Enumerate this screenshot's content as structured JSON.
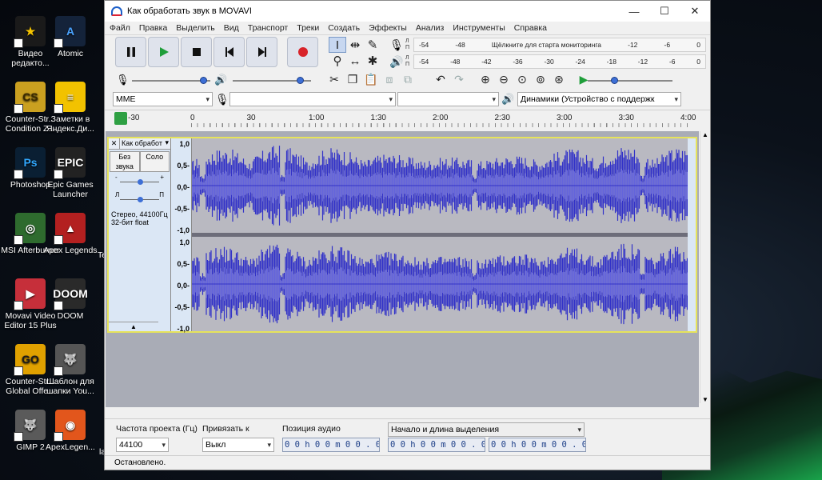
{
  "desktop": {
    "icons": [
      {
        "label": "Видео редакто...",
        "col": 0,
        "row": 0,
        "bg": "#1a1a1a",
        "glyph": "★",
        "fg": "#f5c400"
      },
      {
        "label": "Atomic",
        "col": 1,
        "row": 0,
        "bg": "#14233a",
        "glyph": "A",
        "fg": "#4aa3ff"
      },
      {
        "label": "Counter-Str... Condition Z...",
        "col": 0,
        "row": 1,
        "bg": "#caa020",
        "glyph": "CS",
        "fg": "#3a2a00"
      },
      {
        "label": "Заметки в Яндекс.Ди...",
        "col": 1,
        "row": 1,
        "bg": "#f2c200",
        "glyph": "≡",
        "fg": "#fff"
      },
      {
        "label": "Photoshop",
        "col": 0,
        "row": 2,
        "bg": "#0a1f33",
        "glyph": "Ps",
        "fg": "#31a8ff"
      },
      {
        "label": "Epic Games Launcher",
        "col": 1,
        "row": 2,
        "bg": "#222",
        "glyph": "EPIC",
        "fg": "#fff"
      },
      {
        "label": "MSI Afterburner",
        "col": 0,
        "row": 3,
        "bg": "#2e6b2e",
        "glyph": "◎",
        "fg": "#fff"
      },
      {
        "label": "Apex Legends",
        "col": 1,
        "row": 3,
        "bg": "#b32020",
        "glyph": "▲",
        "fg": "#fff"
      },
      {
        "label": "Movavi Video Editor 15 Plus",
        "col": 0,
        "row": 4,
        "bg": "#c62f3a",
        "glyph": "▶",
        "fg": "#fff"
      },
      {
        "label": "DOOM",
        "col": 1,
        "row": 4,
        "bg": "#2a2a2a",
        "glyph": "DOOM",
        "fg": "#fff"
      },
      {
        "label": "Counter-Str... Global Offe...",
        "col": 0,
        "row": 5,
        "bg": "#e0a100",
        "glyph": "GO",
        "fg": "#1a1a1a"
      },
      {
        "label": "Шаблон для шапки You...",
        "col": 1,
        "row": 5,
        "bg": "#555",
        "glyph": "🐺",
        "fg": "#fff"
      },
      {
        "label": "GIMP 2",
        "col": 0,
        "row": 6,
        "bg": "#5a5a5a",
        "glyph": "🐺",
        "fg": "#fff"
      },
      {
        "label": "ApexLegen...",
        "col": 1,
        "row": 6,
        "bg": "#e2561c",
        "glyph": "◉",
        "fg": "#fff"
      }
    ],
    "partial_labels": {
      "te": "Te",
      "ia": "la"
    }
  },
  "window": {
    "title": "Как обработать звук в MOVAVI",
    "controls": {
      "minimize": "—",
      "maximize": "☐",
      "close": "✕"
    }
  },
  "menu": [
    "Файл",
    "Правка",
    "Выделить",
    "Вид",
    "Транспорт",
    "Треки",
    "Создать",
    "Эффекты",
    "Анализ",
    "Инструменты",
    "Справка"
  ],
  "meters": {
    "record_scale": [
      "-54",
      "-48",
      "Щёлкните для старта мониторинга",
      "-12",
      "-6",
      "0"
    ],
    "play_scale": [
      "-54",
      "-48",
      "-42",
      "-36",
      "-30",
      "-24",
      "-18",
      "-12",
      "-6",
      "0"
    ],
    "lr": [
      "Л",
      "П"
    ]
  },
  "devices": {
    "host": "MME",
    "recording": "",
    "channels": "",
    "playback": "Динамики (Устройство с поддержк"
  },
  "timeline": {
    "ticks": [
      "30",
      "1:00",
      "1:30",
      "2:00",
      "2:30",
      "3:00",
      "3:30",
      "4:00"
    ],
    "start": "0",
    "leading": "-30"
  },
  "track": {
    "name": "Как обработ",
    "mute": "Без звука",
    "solo": "Соло",
    "gain_minus": "-",
    "gain_plus": "+",
    "pan_left": "Л",
    "pan_right": "П",
    "info_line1": "Стерео, 44100Гц",
    "info_line2": "32-бит float",
    "scale": [
      "1,0",
      "0,5-",
      "0,0-",
      "-0,5-",
      "-1,0"
    ],
    "gain_level": 0.5,
    "pan_level": 0.5
  },
  "mixer": {
    "record_volume": 0.95,
    "playback_volume": 0.9,
    "play_speed": 0.3
  },
  "selection_bar": {
    "rate_label": "Частота проекта (Гц)",
    "rate_value": "44100",
    "snap_label": "Привязать к",
    "snap_value": "Выкл",
    "pos_label": "Позиция аудио",
    "pos_value": "0 0 h 0 0 m 0 0 . 0 0 0 s",
    "range_label": "Начало и длина выделения",
    "start_value": "0 0 h 0 0 m 0 0 . 0 0 0 s",
    "end_value": "0 0 h 0 0 m 0 0 . 0 0 0 s"
  },
  "status": "Остановлено.",
  "colors": {
    "wave": "#3232c8",
    "wave_rms": "#6464dc",
    "track_border": "#e6e35a",
    "accent": "#3d6fd6"
  }
}
